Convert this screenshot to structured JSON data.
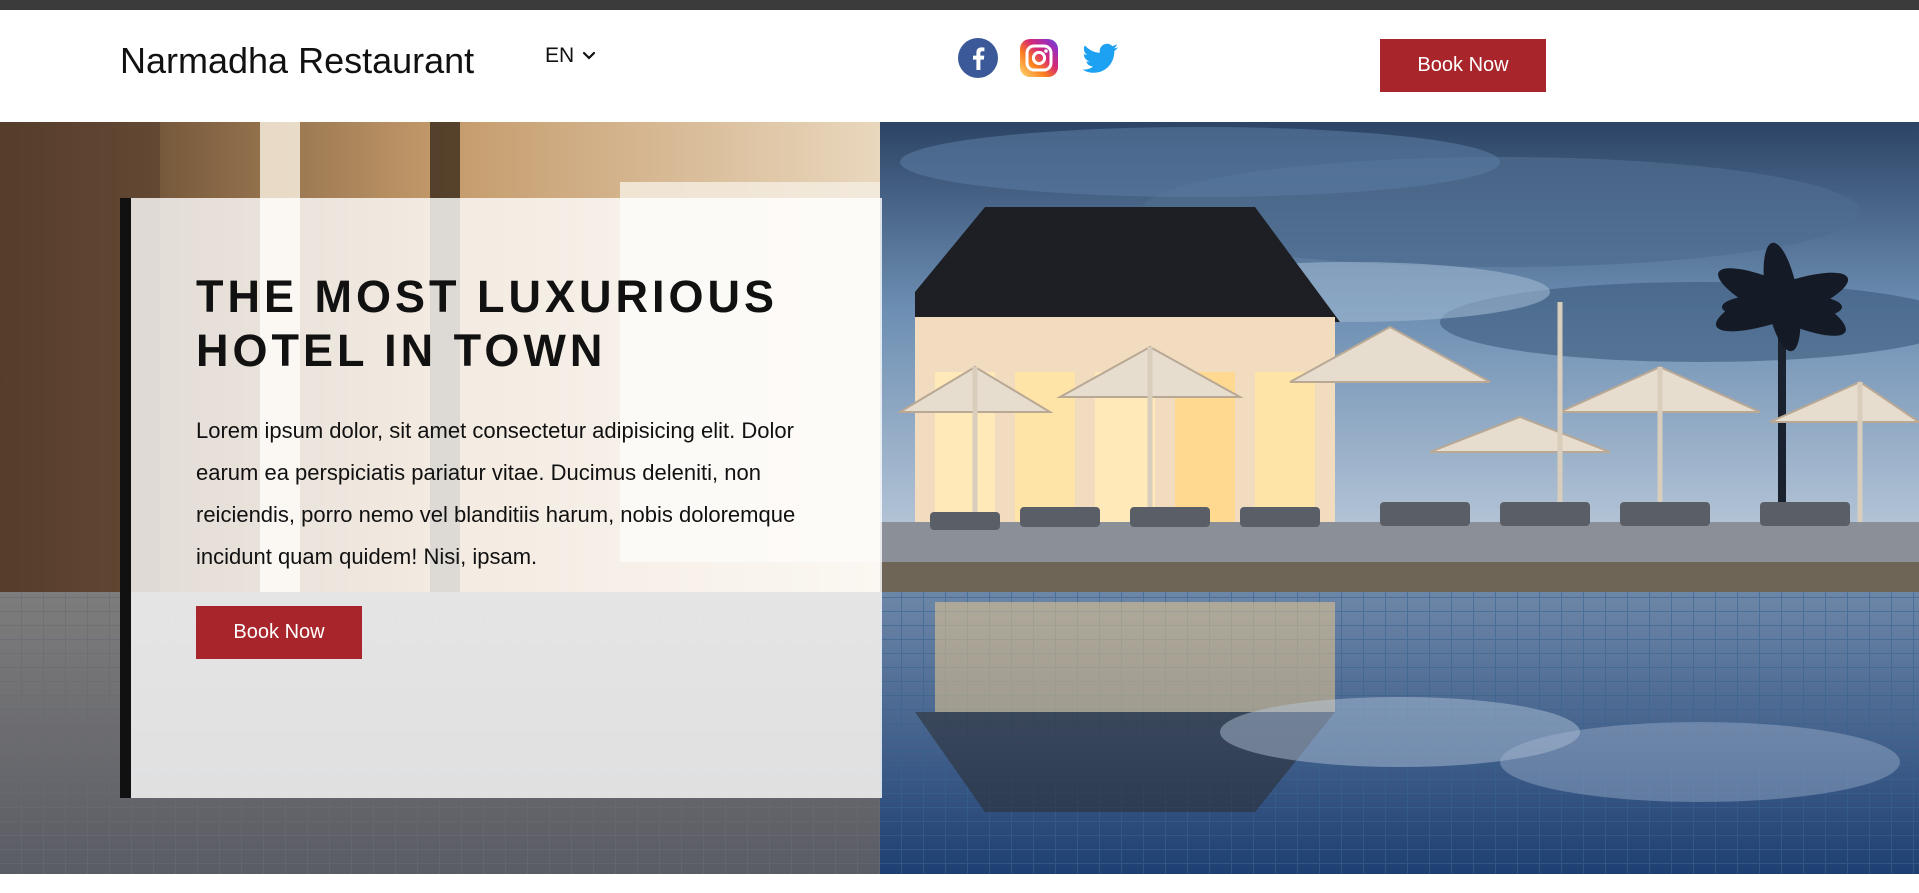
{
  "header": {
    "brand": "Narmadha Restaurant",
    "language": "EN",
    "book_label": "Book Now",
    "social": [
      "facebook-icon",
      "instagram-icon",
      "twitter-icon"
    ]
  },
  "hero": {
    "title_line1": "THE MOST LUXURIOUS",
    "title_line2": "HOTEL IN TOWN",
    "body": "Lorem ipsum dolor, sit amet consectetur adipisicing elit. Dolor earum ea perspiciatis pariatur vitae. Ducimus deleniti, non reiciendis, porro nemo vel blanditiis harum, nobis doloremque incidunt quam quidem! Nisi, ipsam.",
    "book_label": "Book Now"
  },
  "colors": {
    "accent": "#a8262b",
    "topbar": "#3b3b3b",
    "facebook": "#3b5998",
    "twitter": "#1da1f2"
  }
}
